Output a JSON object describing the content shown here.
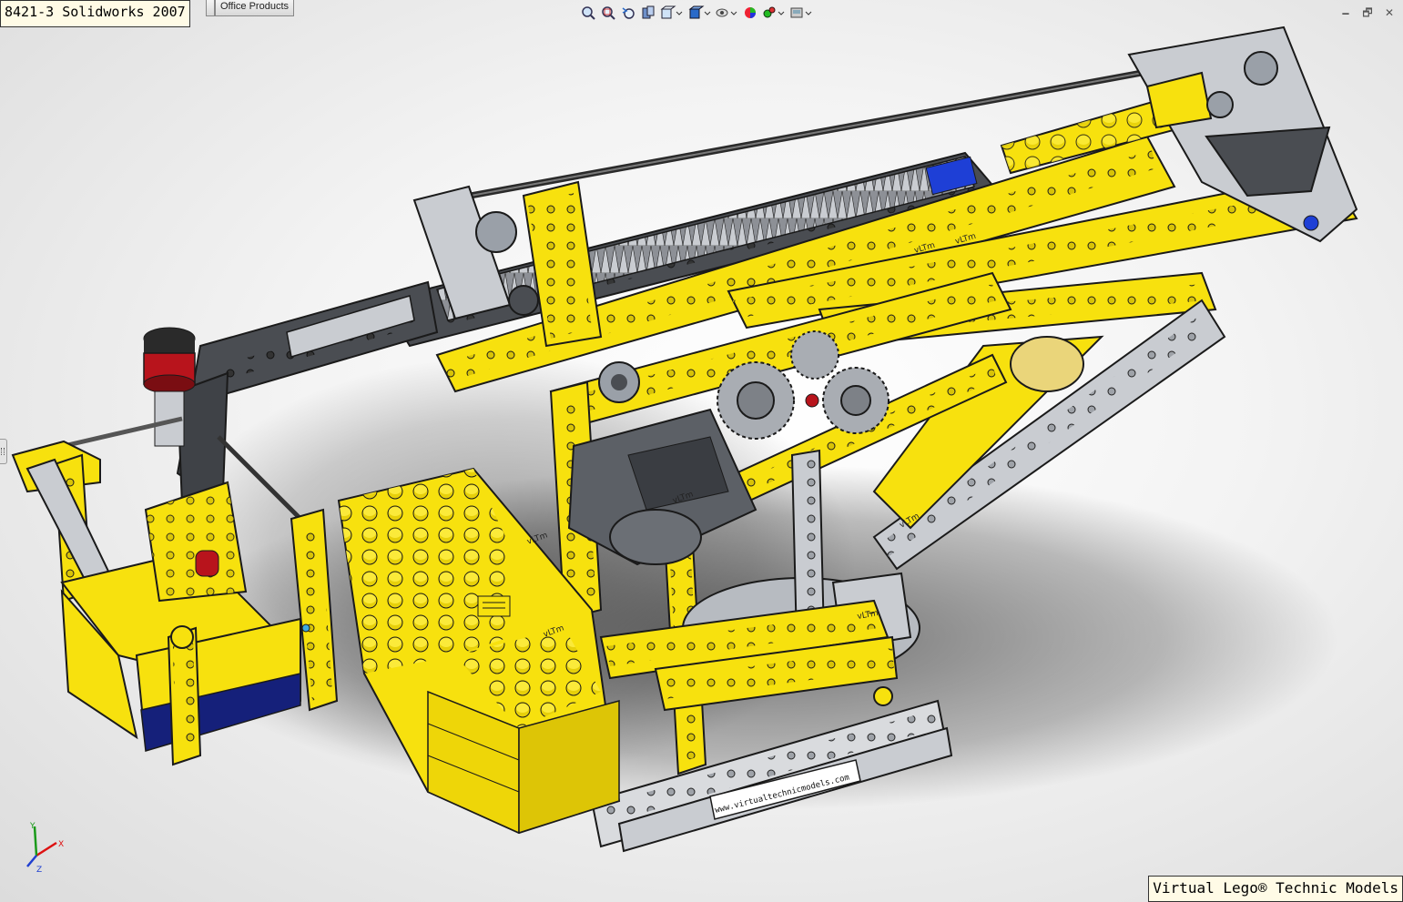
{
  "window": {
    "title": "8421-3 Solidworks 2007"
  },
  "command_manager": {
    "tabs": [
      {
        "label": ""
      },
      {
        "label": "Office Products"
      }
    ]
  },
  "heads_up_toolbar": {
    "items": [
      "zoom-to-fit-icon",
      "zoom-to-area-icon",
      "previous-view-icon",
      "section-view-icon",
      "view-orientation-icon",
      "display-style-icon",
      "hide-show-items-icon",
      "edit-appearance-icon",
      "apply-scene-icon",
      "view-settings-icon"
    ]
  },
  "window_controls": {
    "minimize": "🗕",
    "restore": "🗗",
    "close": "✕"
  },
  "model": {
    "brick_label": "vLTm",
    "plate_text": "www.virtualtechnicmodels.com",
    "colors": {
      "yellow": "#f7e10e",
      "dark_gray": "#4a4d52",
      "light_gray": "#c9ccd1",
      "red": "#b8141c",
      "blue": "#1e3fd6",
      "navy": "#15207a",
      "outline": "#1a1a1a"
    }
  },
  "triad": {
    "x_label": "X",
    "y_label": "Y",
    "z_label": "Z"
  },
  "watermark": {
    "text": "Virtual Lego® Technic Models"
  }
}
